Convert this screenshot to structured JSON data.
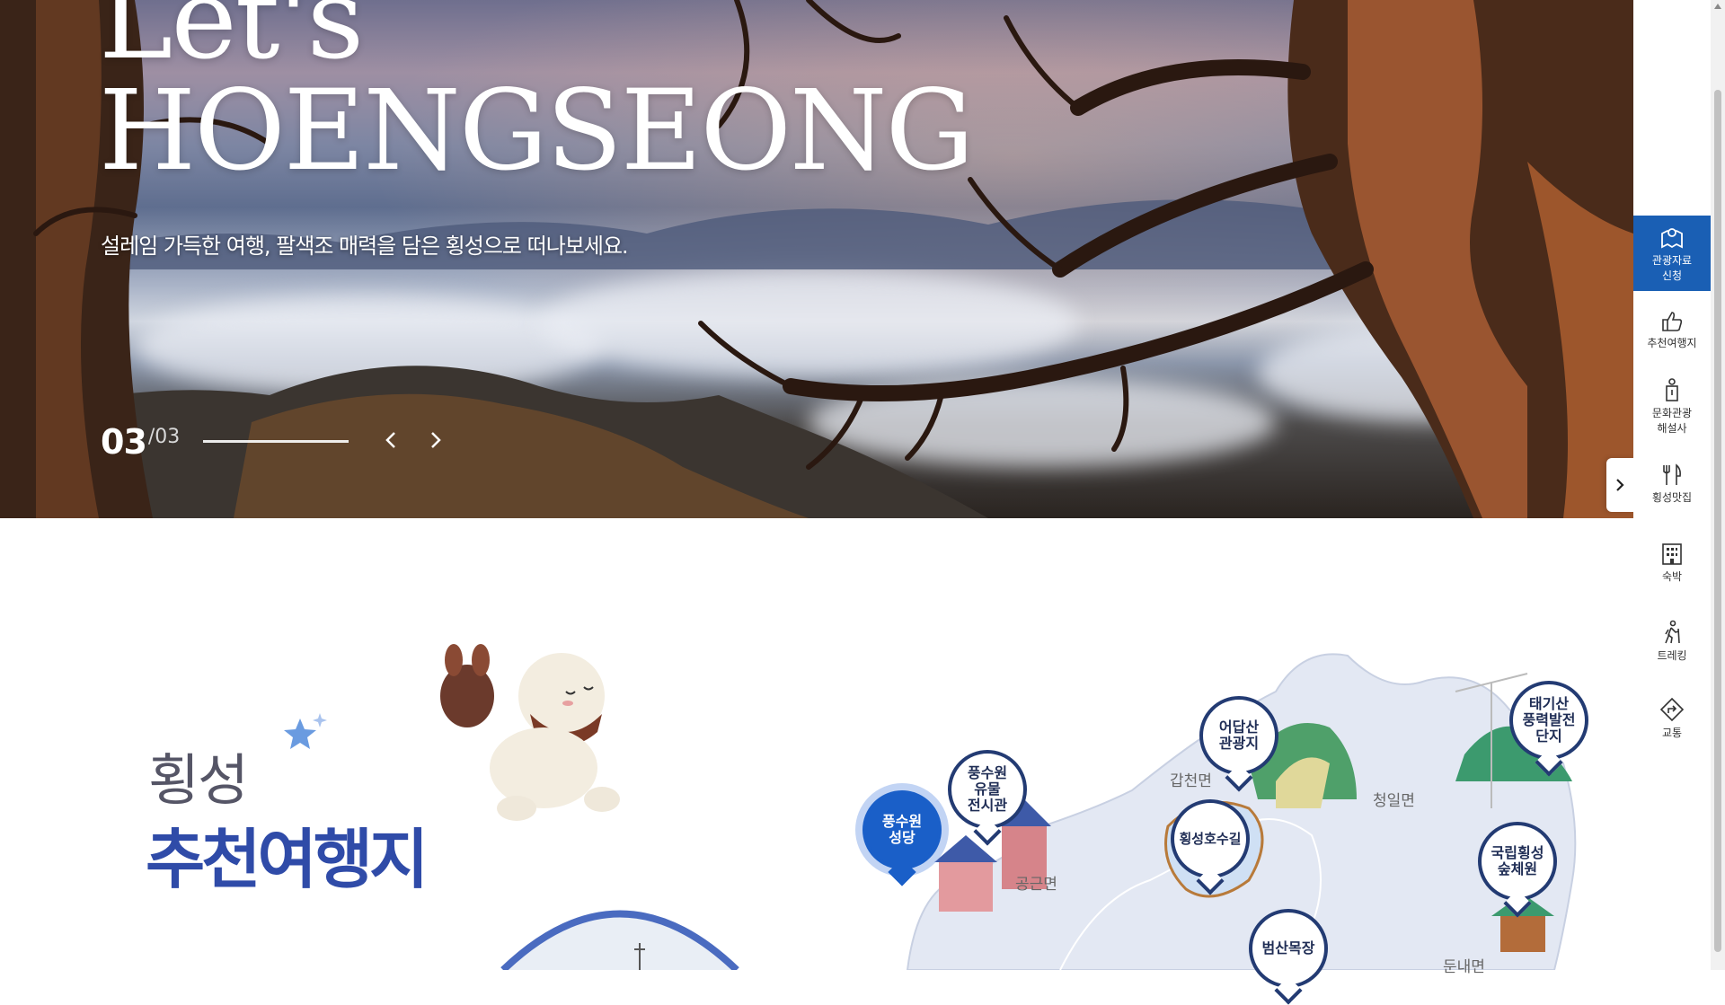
{
  "hero": {
    "title_line1": "Let's",
    "title_line2": "HOENGSEONG",
    "subtitle": "설레임 가득한 여행, 팔색조 매력을 담은 횡성으로 떠나보세요.",
    "slide_current": "03",
    "slide_total": "/03",
    "slide_progress": 1.0,
    "prev_icon": "chevron-left-icon",
    "next_icon": "chevron-right-icon"
  },
  "quick_menu": {
    "toggle_icon": "chevron-right-icon",
    "items": [
      {
        "icon": "map-brochure-icon",
        "line1": "관광자료",
        "line2": "신청",
        "active": true
      },
      {
        "icon": "thumbs-up-icon",
        "line1": "추천여행지",
        "line2": "",
        "active": false
      },
      {
        "icon": "guide-person-icon",
        "line1": "문화관광",
        "line2": "해설사",
        "active": false
      },
      {
        "icon": "fork-knife-icon",
        "line1": "횡성맛집",
        "line2": "",
        "active": false
      },
      {
        "icon": "building-icon",
        "line1": "숙박",
        "line2": "",
        "active": false
      },
      {
        "icon": "hiker-icon",
        "line1": "트레킹",
        "line2": "",
        "active": false
      },
      {
        "icon": "direction-sign-icon",
        "line1": "교통",
        "line2": "",
        "active": false
      }
    ]
  },
  "section": {
    "title_line1": "횡성",
    "title_line2": "추천여행지"
  },
  "map": {
    "pins": [
      {
        "l1": "풍수원",
        "l2": "성당",
        "l3": "",
        "style": "blue"
      },
      {
        "l1": "풍수원",
        "l2": "유물",
        "l3": "전시관",
        "style": "outline"
      },
      {
        "l1": "어답산",
        "l2": "관광지",
        "l3": "",
        "style": "outline"
      },
      {
        "l1": "횡성호수길",
        "l2": "",
        "l3": "",
        "style": "outline"
      },
      {
        "l1": "태기산",
        "l2": "풍력발전",
        "l3": "단지",
        "style": "outline"
      },
      {
        "l1": "국립횡성",
        "l2": "숲체원",
        "l3": "",
        "style": "outline"
      },
      {
        "l1": "범산목장",
        "l2": "",
        "l3": "",
        "style": "outline"
      }
    ],
    "places": [
      "갑천면",
      "청일면",
      "공근면",
      "둔내면"
    ],
    "colors": {
      "accent": "#1a5fc8",
      "pin_border": "#233b73",
      "title": "#2f4ba8"
    }
  }
}
